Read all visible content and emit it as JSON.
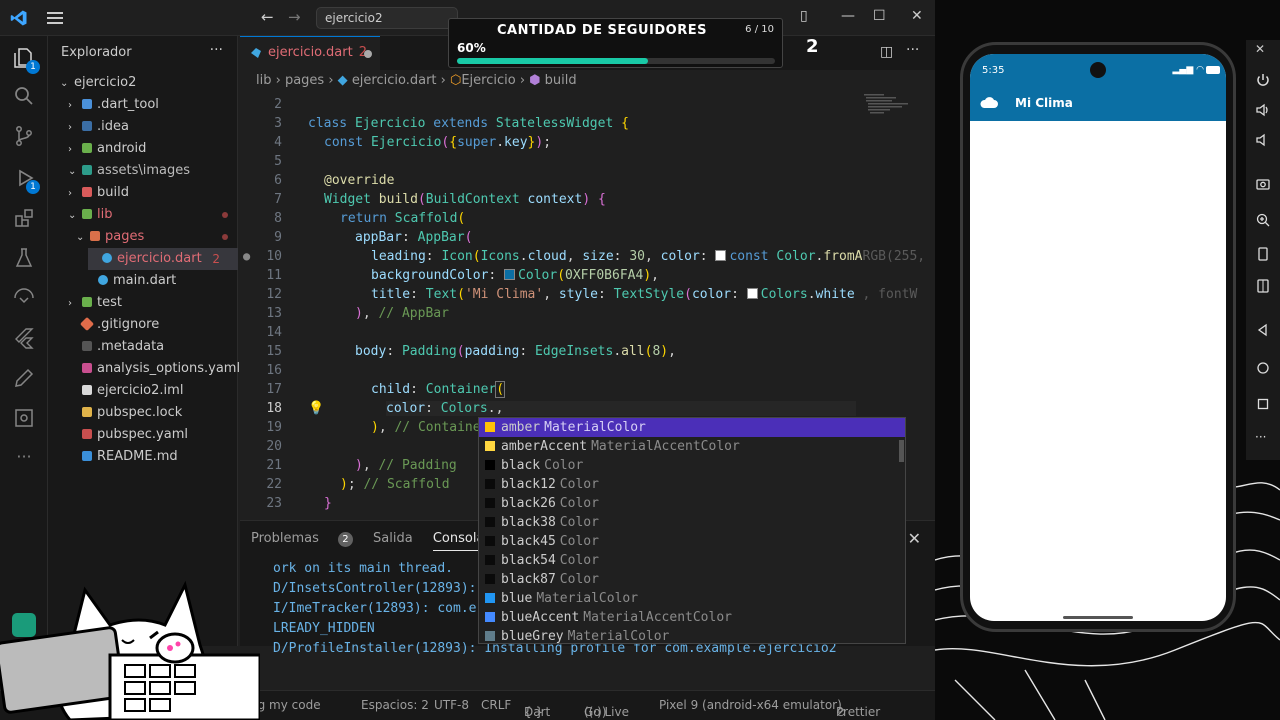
{
  "window": {
    "search": "ejercicio2",
    "nav_back": "←",
    "nav_fwd": "→"
  },
  "explorer": {
    "title": "Explorador",
    "more": "···",
    "items": [
      {
        "label": "ejercicio2"
      },
      {
        "label": ".dart_tool"
      },
      {
        "label": ".idea"
      },
      {
        "label": "android"
      },
      {
        "label": "assets\\images"
      },
      {
        "label": "build"
      },
      {
        "label": "lib"
      },
      {
        "label": "pages"
      },
      {
        "label": "ejercicio.dart",
        "problems": "2"
      },
      {
        "label": "main.dart"
      },
      {
        "label": "test"
      },
      {
        "label": ".gitignore"
      },
      {
        "label": ".metadata"
      },
      {
        "label": "analysis_options.yaml"
      },
      {
        "label": "ejercicio2.iml"
      },
      {
        "label": "pubspec.lock"
      },
      {
        "label": "pubspec.yaml"
      },
      {
        "label": "README.md"
      }
    ]
  },
  "activity": {
    "badge_explorer": "1",
    "badge_debug": "1"
  },
  "tab": {
    "label": "ejercicio.dart",
    "count": "2"
  },
  "breadcrumb": {
    "a": "lib",
    "b": "pages",
    "c": "ejercicio.dart",
    "d": "Ejercicio",
    "e": "build"
  },
  "code": {
    "line_numbers": [
      "2",
      "3",
      "4",
      "5",
      "6",
      "7",
      "8",
      "9",
      "10",
      "11",
      "12",
      "13",
      "14",
      "15",
      "16",
      "17",
      "18",
      "19",
      "20",
      "21",
      "22",
      "23"
    ],
    "current_line": "18"
  },
  "suggestions": [
    {
      "name": "amber",
      "type": "MaterialColor",
      "color": "#ffc107"
    },
    {
      "name": "amberAccent",
      "type": "MaterialAccentColor",
      "color": "#ffd740"
    },
    {
      "name": "black",
      "type": "Color",
      "color": "#000000"
    },
    {
      "name": "black12",
      "type": "Color",
      "color": "#0a0a0a"
    },
    {
      "name": "black26",
      "type": "Color",
      "color": "#0a0a0a"
    },
    {
      "name": "black38",
      "type": "Color",
      "color": "#0a0a0a"
    },
    {
      "name": "black45",
      "type": "Color",
      "color": "#0a0a0a"
    },
    {
      "name": "black54",
      "type": "Color",
      "color": "#0a0a0a"
    },
    {
      "name": "black87",
      "type": "Color",
      "color": "#0a0a0a"
    },
    {
      "name": "blue",
      "type": "MaterialColor",
      "color": "#2196f3"
    },
    {
      "name": "blueAccent",
      "type": "MaterialAccentColor",
      "color": "#448aff"
    },
    {
      "name": "blueGrey",
      "type": "MaterialColor",
      "color": "#607d8b"
    }
  ],
  "panel": {
    "problems": "Problemas",
    "problems_count": "2",
    "output": "Salida",
    "console": "Consola De D",
    "lines": [
      "ork on its main thread.",
      "D/InsetsController(12893): ",
      "I/ImeTracker(12893): com.e",
      "LREADY_HIDDEN",
      "D/ProfileInstaller(12893): Installing profile for com.example.ejercicio2"
    ],
    "prompt": ">"
  },
  "status": {
    "left": "ug my code",
    "spaces": "Espacios: 2",
    "encoding": "UTF-8",
    "eol": "CRLF",
    "lang": "Dart",
    "golive": "Go Live",
    "device": "Pixel 9 (android-x64 emulator)",
    "prettier": "Prettier"
  },
  "overlay": {
    "title": "CANTIDAD DE SEGUIDORES",
    "count": "6 / 10",
    "percent_label": "60%",
    "progress": 0.6,
    "number": "2"
  },
  "phone": {
    "time": "5:35",
    "app_title": "Mi Clima",
    "appbar_color": "#0b6fa4"
  }
}
